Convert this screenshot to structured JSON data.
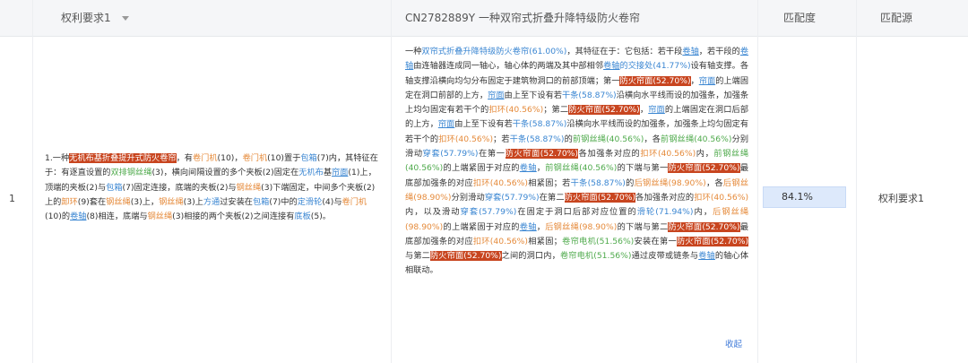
{
  "header": {
    "claim_col": "权利要求1",
    "doc_col": "CN2782889Y 一种双帘式折叠升降特级防火卷帘",
    "score_col": "匹配度",
    "source_col": "匹配源"
  },
  "row": {
    "index": "1",
    "score": "84.1%",
    "source": "权利要求1",
    "collapse": "收起"
  },
  "claim_segments": [
    {
      "t": "1.一种",
      "c": ""
    },
    {
      "t": "无机布基折叠提升式防火卷帘",
      "c": "hl"
    },
    {
      "t": "，有",
      "c": ""
    },
    {
      "t": "卷门机",
      "c": "o"
    },
    {
      "t": "(10)，",
      "c": ""
    },
    {
      "t": "卷门机",
      "c": "o"
    },
    {
      "t": "(10)置于",
      "c": ""
    },
    {
      "t": "包箱",
      "c": "b"
    },
    {
      "t": "(7)内，其特征在于：有逐直设置的",
      "c": ""
    },
    {
      "t": "双排钢丝绳",
      "c": "g"
    },
    {
      "t": "(3)，横向间隔设置的多个夹板(2)固定在",
      "c": ""
    },
    {
      "t": "无机布",
      "c": "b"
    },
    {
      "t": "基",
      "c": ""
    },
    {
      "t": "帘面",
      "c": "u"
    },
    {
      "t": "(1)上，顶端的夹板(2)与",
      "c": ""
    },
    {
      "t": "包箱",
      "c": "b"
    },
    {
      "t": "(7)固定连接，底端的夹板(2)与",
      "c": ""
    },
    {
      "t": "钢丝绳",
      "c": "o"
    },
    {
      "t": "(3)下端固定，中间多个夹板(2)上的",
      "c": ""
    },
    {
      "t": "卸环",
      "c": "o"
    },
    {
      "t": "(9)套在",
      "c": ""
    },
    {
      "t": "钢丝绳",
      "c": "o"
    },
    {
      "t": "(3)上，",
      "c": ""
    },
    {
      "t": "钢丝绳",
      "c": "o"
    },
    {
      "t": "(3)上",
      "c": ""
    },
    {
      "t": "方通",
      "c": "b"
    },
    {
      "t": "过安装在",
      "c": ""
    },
    {
      "t": "包箱",
      "c": "b"
    },
    {
      "t": "(7)中的",
      "c": ""
    },
    {
      "t": "定滑轮",
      "c": "b"
    },
    {
      "t": "(4)与",
      "c": ""
    },
    {
      "t": "卷门机",
      "c": "o"
    },
    {
      "t": "(10)的",
      "c": ""
    },
    {
      "t": "卷轴",
      "c": "u"
    },
    {
      "t": "(8)相连，底端与",
      "c": ""
    },
    {
      "t": "钢丝绳",
      "c": "o"
    },
    {
      "t": "(3)相接的两个夹板(2)之间连接有",
      "c": ""
    },
    {
      "t": "底板",
      "c": "b"
    },
    {
      "t": "(5)。",
      "c": ""
    }
  ],
  "doc_segments": [
    {
      "t": "一种",
      "c": ""
    },
    {
      "t": "双帘式折叠升降特级防火卷帘(61.00%)",
      "c": "b"
    },
    {
      "t": "，其特征在于：它包括：若干段",
      "c": ""
    },
    {
      "t": "卷轴",
      "c": "u"
    },
    {
      "t": "，若干段的",
      "c": ""
    },
    {
      "t": "卷轴",
      "c": "u"
    },
    {
      "t": "由连轴器连成同一轴心，轴心体的两端及其中部相邻",
      "c": ""
    },
    {
      "t": "卷轴",
      "c": "u"
    },
    {
      "t": "的交接处(41.77%)",
      "c": "b"
    },
    {
      "t": "设有轴支撑。各轴支撑沿横向均匀分布固定于建筑物洞口的前部顶端；第一",
      "c": ""
    },
    {
      "t": "防火帘面(52.70%)",
      "c": "hl"
    },
    {
      "t": "，",
      "c": ""
    },
    {
      "t": "帘面",
      "c": "u"
    },
    {
      "t": "的上端固定在洞口前部的上方，",
      "c": ""
    },
    {
      "t": "帘面",
      "c": "u"
    },
    {
      "t": "由上至下设有若",
      "c": ""
    },
    {
      "t": "干条(58.87%)",
      "c": "b"
    },
    {
      "t": "沿横向水平线而设的加强条，加强条上均匀固定有若干个的",
      "c": ""
    },
    {
      "t": "扣环(40.56%)",
      "c": "o"
    },
    {
      "t": "；第二",
      "c": ""
    },
    {
      "t": "防火帘面(52.70%)",
      "c": "hl"
    },
    {
      "t": "，",
      "c": ""
    },
    {
      "t": "帘面",
      "c": "u"
    },
    {
      "t": "的上端固定在洞口后部的上方，",
      "c": ""
    },
    {
      "t": "帘面",
      "c": "u"
    },
    {
      "t": "由上至下设有若",
      "c": ""
    },
    {
      "t": "干条(58.87%)",
      "c": "b"
    },
    {
      "t": "沿横向水平线而设的加强条，加强条上均匀固定有若干个的",
      "c": ""
    },
    {
      "t": "扣环(40.56%)",
      "c": "o"
    },
    {
      "t": "；若",
      "c": ""
    },
    {
      "t": "干条(58.87%)",
      "c": "b"
    },
    {
      "t": "的",
      "c": ""
    },
    {
      "t": "前钢丝绳(40.56%)",
      "c": "g"
    },
    {
      "t": "，各",
      "c": ""
    },
    {
      "t": "前钢丝绳(40.56%)",
      "c": "g"
    },
    {
      "t": "分别滑动",
      "c": ""
    },
    {
      "t": "穿套(57.79%)",
      "c": "b"
    },
    {
      "t": "在第一",
      "c": ""
    },
    {
      "t": "防火帘面(52.70%)",
      "c": "hl"
    },
    {
      "t": "各加强条对应的",
      "c": ""
    },
    {
      "t": "扣环(40.56%)",
      "c": "o"
    },
    {
      "t": "内，",
      "c": ""
    },
    {
      "t": "前钢丝绳(40.56%)",
      "c": "g"
    },
    {
      "t": "的上端紧固于对应的",
      "c": ""
    },
    {
      "t": "卷轴",
      "c": "u"
    },
    {
      "t": "，",
      "c": ""
    },
    {
      "t": "前钢丝绳(40.56%)",
      "c": "g"
    },
    {
      "t": "的下端与第一",
      "c": ""
    },
    {
      "t": "防火帘面(52.70%)",
      "c": "hl"
    },
    {
      "t": "最底部加强条的对应",
      "c": ""
    },
    {
      "t": "扣环(40.56%)",
      "c": "o"
    },
    {
      "t": "相紧固；若",
      "c": ""
    },
    {
      "t": "干条(58.87%)",
      "c": "b"
    },
    {
      "t": "的",
      "c": ""
    },
    {
      "t": "后钢丝绳(98.90%)",
      "c": "o"
    },
    {
      "t": "，各",
      "c": ""
    },
    {
      "t": "后钢丝绳(98.90%)",
      "c": "o"
    },
    {
      "t": "分别滑动",
      "c": ""
    },
    {
      "t": "穿套(57.79%)",
      "c": "b"
    },
    {
      "t": "在第二",
      "c": ""
    },
    {
      "t": "防火帘面(52.70%)",
      "c": "hl"
    },
    {
      "t": "各加强条对应的",
      "c": ""
    },
    {
      "t": "扣环(40.56%)",
      "c": "o"
    },
    {
      "t": "内，以及滑动",
      "c": ""
    },
    {
      "t": "穿套(57.79%)",
      "c": "b"
    },
    {
      "t": "在固定于洞口后部对应位置的",
      "c": ""
    },
    {
      "t": "滑轮(71.94%)",
      "c": "b"
    },
    {
      "t": "内，",
      "c": ""
    },
    {
      "t": "后钢丝绳(98.90%)",
      "c": "o"
    },
    {
      "t": "的上端紧固于对应的",
      "c": ""
    },
    {
      "t": "卷轴",
      "c": "u"
    },
    {
      "t": "，",
      "c": ""
    },
    {
      "t": "后钢丝绳(98.90%)",
      "c": "o"
    },
    {
      "t": "的下端与第二",
      "c": ""
    },
    {
      "t": "防火帘面(52.70%)",
      "c": "hl"
    },
    {
      "t": "最底部加强条的对应",
      "c": ""
    },
    {
      "t": "扣环(40.56%)",
      "c": "o"
    },
    {
      "t": "相紧固；",
      "c": ""
    },
    {
      "t": "卷帘电机(51.56%)",
      "c": "g"
    },
    {
      "t": "安装在第一",
      "c": ""
    },
    {
      "t": "防火帘面(52.70%)",
      "c": "hl"
    },
    {
      "t": "与第二",
      "c": ""
    },
    {
      "t": "防火帘面(52.70%)",
      "c": "hl"
    },
    {
      "t": "之间的洞口内，",
      "c": ""
    },
    {
      "t": "卷帘电机(51.56%)",
      "c": "g"
    },
    {
      "t": "通过皮带或链条与",
      "c": ""
    },
    {
      "t": "卷轴",
      "c": "u"
    },
    {
      "t": "的轴心体相联动。",
      "c": ""
    }
  ]
}
